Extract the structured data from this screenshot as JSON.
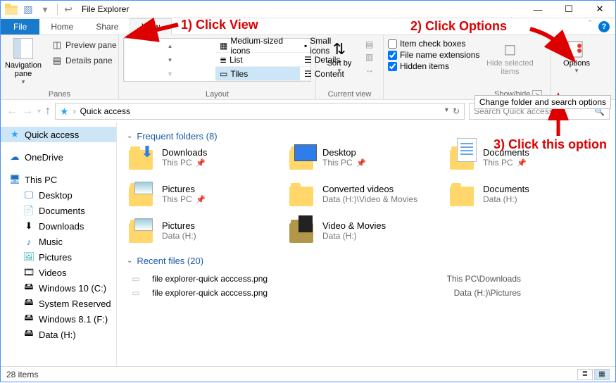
{
  "window": {
    "title": "File Explorer"
  },
  "tabs": {
    "file": "File",
    "home": "Home",
    "share": "Share",
    "view": "View"
  },
  "ribbon": {
    "panes": {
      "nav": "Navigation pane",
      "preview": "Preview pane",
      "details": "Details pane",
      "label": "Panes"
    },
    "layout": {
      "medium": "Medium-sized icons",
      "small": "Small icons",
      "list": "List",
      "details": "Details",
      "tiles": "Tiles",
      "content": "Content",
      "label": "Layout"
    },
    "currentview": {
      "sortby": "Sort by",
      "groupby": "Group by",
      "addcols": "Add columns",
      "sizecols": "Size all columns to fit",
      "label": "Current view"
    },
    "showhide": {
      "itemcheck": "Item check boxes",
      "ext": "File name extensions",
      "hidden": "Hidden items",
      "hidesel": "Hide selected items",
      "label": "Show/hide"
    },
    "options": "Options",
    "changeopts": "Change folder and search options"
  },
  "address": {
    "path": "Quick access",
    "search_placeholder": "Search Quick access"
  },
  "navtree": {
    "quick": "Quick access",
    "onedrive": "OneDrive",
    "thispc": "This PC",
    "desktop": "Desktop",
    "documents": "Documents",
    "downloads": "Downloads",
    "music": "Music",
    "pictures": "Pictures",
    "videos": "Videos",
    "win10": "Windows 10 (C:)",
    "sysres": "System Reserved",
    "win81": "Windows 8.1 (F:)",
    "datah": "Data (H:)"
  },
  "main": {
    "freq_header": "Frequent folders (8)",
    "recent_header": "Recent files (20)",
    "tiles": [
      {
        "name": "Downloads",
        "path": "This PC",
        "pinned": true,
        "icon": "downloads"
      },
      {
        "name": "Desktop",
        "path": "This PC",
        "pinned": true,
        "icon": "desktop"
      },
      {
        "name": "Documents",
        "path": "This PC",
        "pinned": true,
        "icon": "documents"
      },
      {
        "name": "Pictures",
        "path": "This PC",
        "pinned": true,
        "icon": "pictures"
      },
      {
        "name": "Converted videos",
        "path": "Data (H:)\\Video & Movies",
        "pinned": false,
        "icon": "folder"
      },
      {
        "name": "Documents",
        "path": "Data (H:)",
        "pinned": false,
        "icon": "folder"
      },
      {
        "name": "Pictures",
        "path": "Data (H:)",
        "pinned": false,
        "icon": "pictures2"
      },
      {
        "name": "Video & Movies",
        "path": "Data (H:)",
        "pinned": false,
        "icon": "folder-dark"
      }
    ],
    "recent": [
      {
        "name": "file explorer-quick acccess.png",
        "loc": "This PC\\Downloads"
      },
      {
        "name": "file explorer-quick acccess.png",
        "loc": "Data (H:)\\Pictures"
      }
    ]
  },
  "status": {
    "items": "28 items"
  },
  "annotations": {
    "a1": "1) Click View",
    "a2": "2) Click Options",
    "a3": "3) Click this option",
    "changeopts_tip": "Change folder and search options"
  }
}
